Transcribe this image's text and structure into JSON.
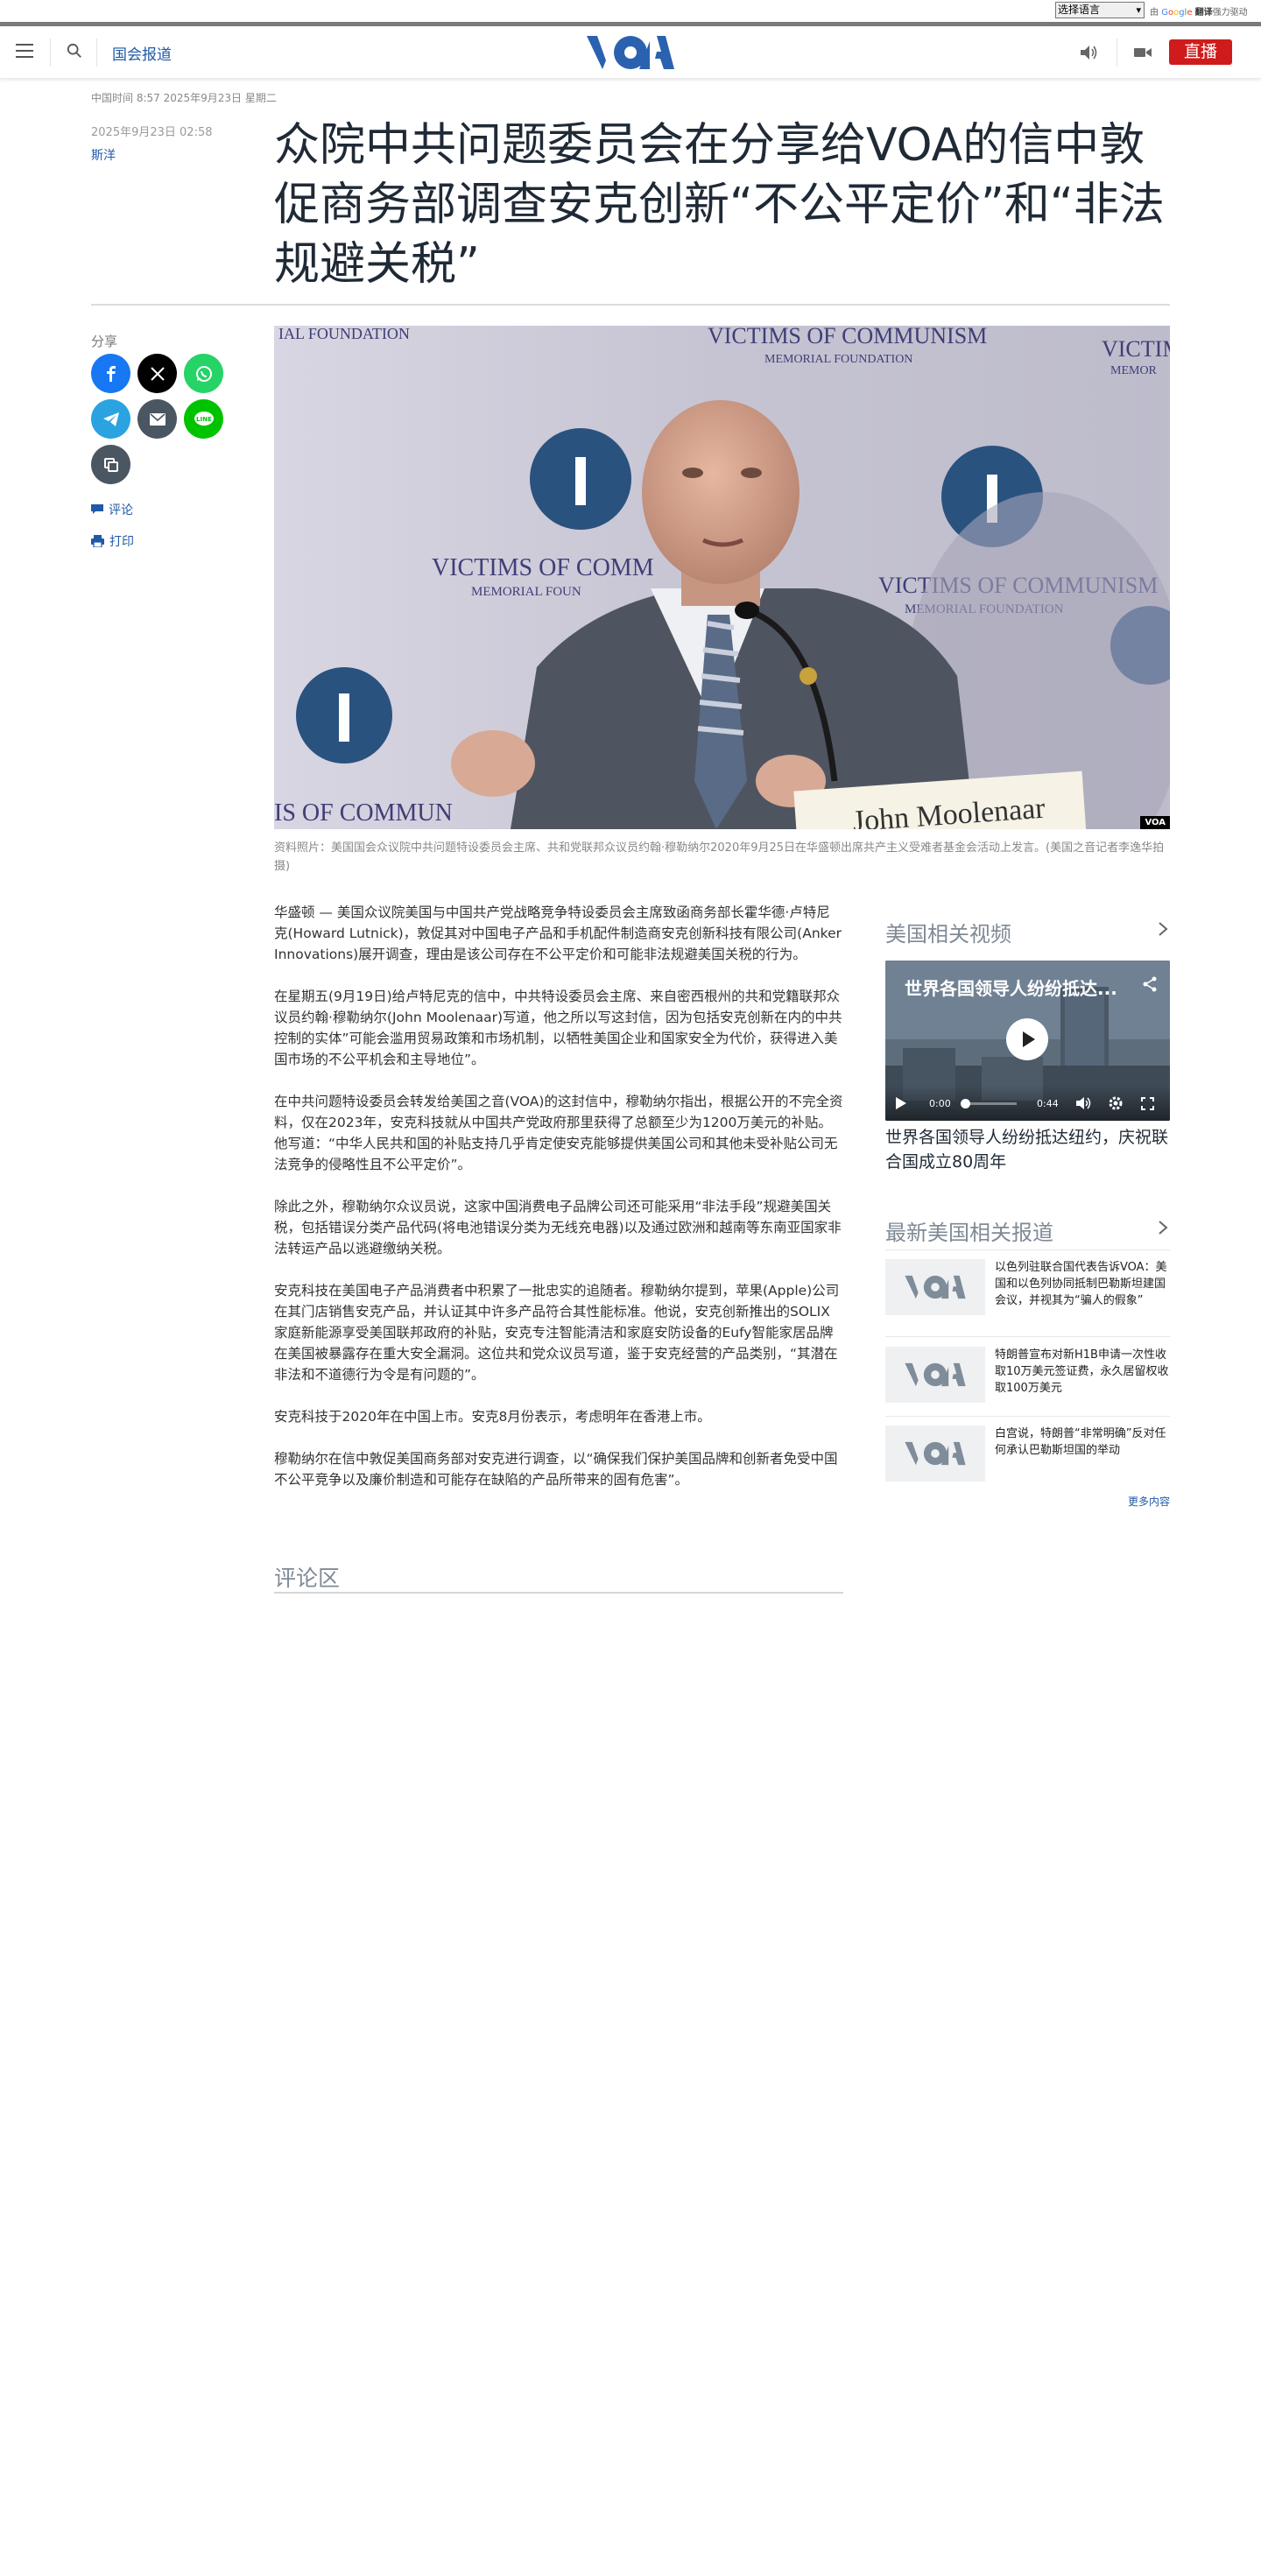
{
  "translate": {
    "select_label": "选择语言",
    "powered_prefix": "由",
    "google": "Google",
    "translate_word": "翻译",
    "powered_suffix": "强力驱动"
  },
  "header": {
    "section": "国会报道",
    "live": "直播",
    "logo": "VOA"
  },
  "article": {
    "dateline": "中国时间 8:57 2025年9月23日 星期二",
    "published": "2025年9月23日 02:58",
    "author": "斯洋",
    "title": "众院中共问题委员会在分享给VOA的信中敦促商务部调查安克创新“不公平定价”和“非法规避关税”",
    "photo_tag": "VOA",
    "caption": "资料照片：美国国会众议院中共问题特设委员会主席、共和党联邦众议员约翰·穆勒纳尔2020年9月25日在华盛顿出席共产主义受难者基金会活动上发言。(美国之音记者李逸华拍摄)",
    "paragraphs": [
      "华盛顿 — 美国众议院美国与中国共产党战略竞争特设委员会主席致函商务部长霍华德·卢特尼克(Howard Lutnick)，敦促其对中国电子产品和手机配件制造商安克创新科技有限公司(Anker Innovations)展开调查，理由是该公司存在不公平定价和可能非法规避美国关税的行为。",
      "在星期五(9月19日)给卢特尼克的信中，中共特设委员会主席、来自密西根州的共和党籍联邦众议员约翰·穆勒纳尔(John Moolenaar)写道，他之所以写这封信，因为包括安克创新在内的中共控制的实体”可能会滥用贸易政策和市场机制，以牺牲美国企业和国家安全为代价，获得进入美国市场的不公平机会和主导地位”。",
      "在中共问题特设委员会转发给美国之音(VOA)的这封信中，穆勒纳尔指出，根据公开的不完全资料，仅在2023年，安克科技就从中国共产党政府那里获得了总额至少为1200万美元的补贴。他写道：“中华人民共和国的补贴支持几乎肯定使安克能够提供美国公司和其他未受补贴公司无法竞争的侵略性且不公平定价”。",
      "除此之外，穆勒纳尔众议员说，这家中国消费电子品牌公司还可能采用“非法手段”规避美国关税，包括错误分类产品代码(将电池错误分类为无线充电器)以及通过欧洲和越南等东南亚国家非法转运产品以逃避缴纳关税。",
      "安克科技在美国电子产品消费者中积累了一批忠实的追随者。穆勒纳尔提到，苹果(Apple)公司在其门店销售安克产品，并认证其中许多产品符合其性能标准。他说，安克创新推出的SOLIX家庭新能源享受美国联邦政府的补贴，安克专注智能清洁和家庭安防设备的Eufy智能家居品牌在美国被暴露存在重大安全漏洞。这位共和党众议员写道，鉴于安克经营的产品类别，“其潜在非法和不道德行为令是有问题的”。",
      "安克科技于2020年在中国上市。安克8月份表示，考虑明年在香港上市。",
      "穆勒纳尔在信中敦促美国商务部对安克进行调查，以“确保我们保护美国品牌和创新者免受中国不公平竞争以及廉价制造和可能存在缺陷的产品所带来的固有危害”。"
    ],
    "comments_title": "评论区"
  },
  "share": {
    "label": "分享",
    "comment": "评论",
    "print": "打印"
  },
  "sidebar": {
    "videos_heading": "美国相关视频",
    "video": {
      "overlay_title": "世界各国领导人纷纷抵达...",
      "time_current": "0:00",
      "time_total": "0:44",
      "caption": "世界各国领导人纷纷抵达纽约，庆祝联合国成立80周年"
    },
    "latest_heading": "最新美国相关报道",
    "news": [
      {
        "title": "以色列驻联合国代表告诉VOA：美国和以色列协同抵制巴勒斯坦建国会议，并视其为“骗人的假象”"
      },
      {
        "title": "特朗普宣布对新H1B申请一次性收取10万美元签证费，永久居留权收取100万美元"
      },
      {
        "title": "白宫说，特朗普“非常明确”反对任何承认巴勒斯坦国的举动"
      }
    ],
    "more": "更多内容"
  },
  "colors": {
    "accent_blue": "#2059a8",
    "live_red": "#cf1b1b",
    "facebook": "#1877f2",
    "x": "#000000",
    "whatsapp": "#25d366",
    "telegram": "#2aa3e0",
    "email": "#4a5661",
    "line": "#00c300",
    "copy": "#4a5661"
  }
}
